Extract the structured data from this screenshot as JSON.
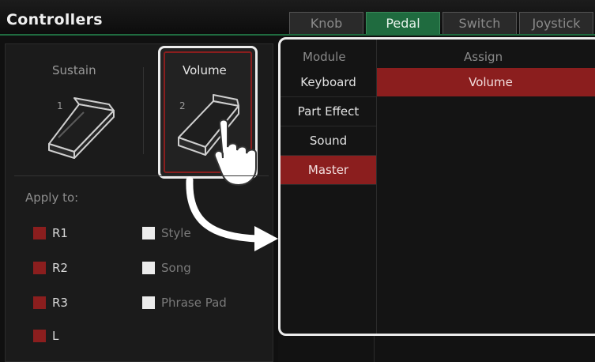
{
  "header": {
    "title": "Controllers",
    "tabs": [
      {
        "label": "Knob",
        "active": false
      },
      {
        "label": "Pedal",
        "active": true
      },
      {
        "label": "Switch",
        "active": false
      },
      {
        "label": "Joystick",
        "active": false
      }
    ]
  },
  "pedals": {
    "sustain": {
      "label": "Sustain",
      "number": "1"
    },
    "volume": {
      "label": "Volume",
      "number": "2",
      "selected": true
    }
  },
  "apply": {
    "label": "Apply to:",
    "parts": [
      {
        "label": "R1",
        "checked": true
      },
      {
        "label": "R2",
        "checked": true
      },
      {
        "label": "R3",
        "checked": true
      },
      {
        "label": "L",
        "checked": true
      }
    ],
    "others": [
      {
        "label": "Style",
        "checked": false
      },
      {
        "label": "Song",
        "checked": false
      },
      {
        "label": "Phrase Pad",
        "checked": false
      }
    ]
  },
  "assign_panel": {
    "module_header": "Module",
    "assign_header": "Assign",
    "modules": [
      "Keyboard",
      "Part Effect",
      "Sound",
      "Master"
    ],
    "selected_module": "Master",
    "assign_items": [
      "Volume"
    ]
  },
  "colors": {
    "accent_green": "#1f6b3f",
    "selected_red": "#8b1e1e",
    "highlight_border": "#ececec"
  }
}
